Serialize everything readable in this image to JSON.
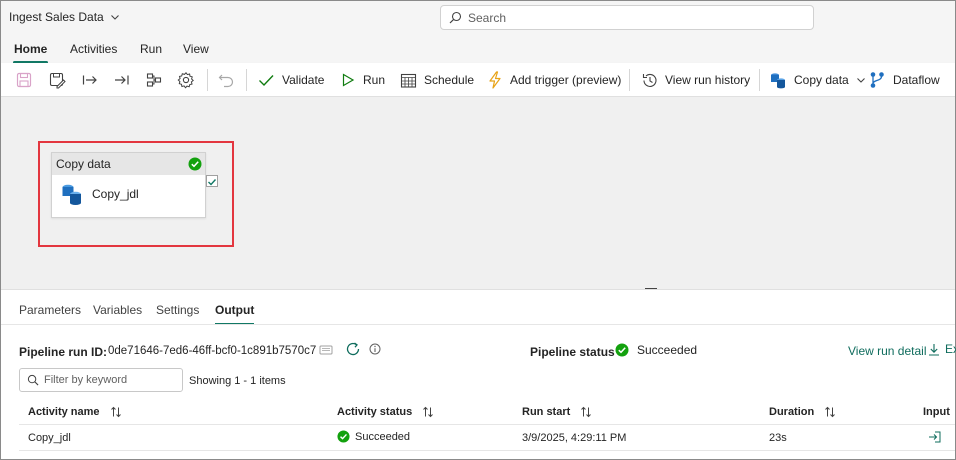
{
  "app": {
    "title": "Ingest Sales Data"
  },
  "search": {
    "placeholder": "Search"
  },
  "menu": {
    "tabs": [
      {
        "label": "Home",
        "active": true
      },
      {
        "label": "Activities"
      },
      {
        "label": "Run"
      },
      {
        "label": "View"
      }
    ]
  },
  "toolbar": {
    "validate": "Validate",
    "run": "Run",
    "schedule": "Schedule",
    "add_trigger": "Add trigger (preview)",
    "view_run_history": "View run history",
    "copy_data": "Copy data",
    "dataflow": "Dataflow"
  },
  "canvas": {
    "activity": {
      "type_label": "Copy data",
      "name": "Copy_jdl",
      "status": "succeeded"
    }
  },
  "panel": {
    "tabs": [
      {
        "label": "Parameters"
      },
      {
        "label": "Variables"
      },
      {
        "label": "Settings"
      },
      {
        "label": "Output",
        "active": true
      }
    ],
    "run_id_label": "Pipeline run ID:",
    "run_id": "0de71646-7ed6-46ff-bcf0-1c891b7570c7",
    "status_label": "Pipeline status",
    "status": "Succeeded",
    "view_run_detail": "View run detail",
    "export": "Exp",
    "filter_placeholder": "Filter by keyword",
    "showing": "Showing 1 - 1 items",
    "columns": [
      "Activity name",
      "Activity status",
      "Run start",
      "Duration",
      "Input"
    ],
    "rows": [
      {
        "activity_name": "Copy_jdl",
        "status": "Succeeded",
        "run_start": "3/9/2025, 4:29:11 PM",
        "duration": "23s"
      }
    ]
  },
  "colors": {
    "accent": "#117865",
    "success": "#13a10e",
    "highlight": "#e3363f",
    "link": "#0f6c5d"
  }
}
